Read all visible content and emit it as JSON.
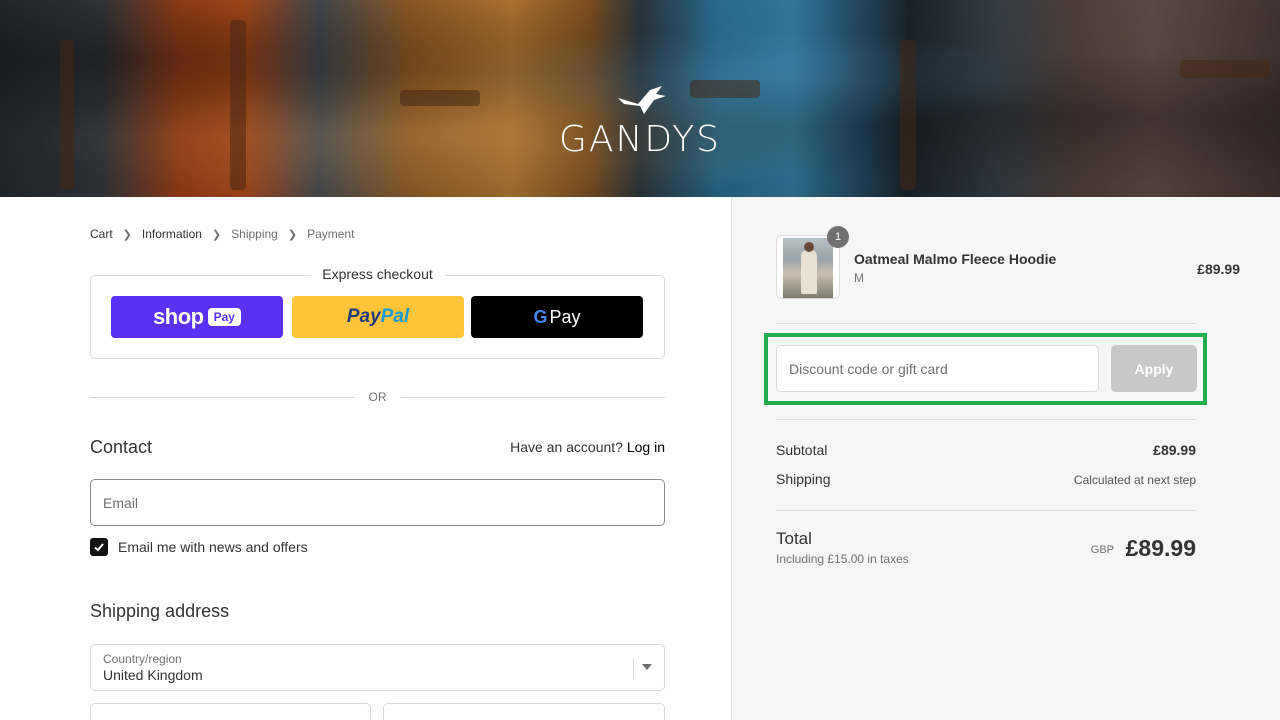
{
  "brand": {
    "name": "GANDYS"
  },
  "breadcrumb": [
    "Cart",
    "Information",
    "Shipping",
    "Payment"
  ],
  "express": {
    "legend": "Express checkout",
    "shop_label": "shop",
    "shop_pill": "Pay",
    "paypal_part1": "Pay",
    "paypal_part2": "Pal",
    "gpay_g": "G",
    "gpay_label": "Pay"
  },
  "or_label": "OR",
  "contact": {
    "title": "Contact",
    "account_prompt": "Have an account?",
    "login_label": "Log in",
    "email_placeholder": "Email",
    "newsletter_label": "Email me with news and offers",
    "newsletter_checked": true
  },
  "shipping": {
    "title": "Shipping address",
    "country_label": "Country/region",
    "country_value": "United Kingdom"
  },
  "order": {
    "product_name": "Oatmeal Malmo Fleece Hoodie",
    "variant": "M",
    "quantity": "1",
    "price": "£89.99",
    "discount_placeholder": "Discount code or gift card",
    "apply_label": "Apply",
    "subtotal_label": "Subtotal",
    "subtotal_value": "£89.99",
    "shipping_label": "Shipping",
    "shipping_value": "Calculated at next step",
    "total_label": "Total",
    "tax_note": "Including £15.00 in taxes",
    "currency": "GBP",
    "total_value": "£89.99"
  },
  "colors": {
    "shop_pay": "#5a31f4",
    "paypal": "#ffc439",
    "gpay": "#000000",
    "highlight": "#1fae4b",
    "apply_disabled": "#c8c8c8"
  }
}
